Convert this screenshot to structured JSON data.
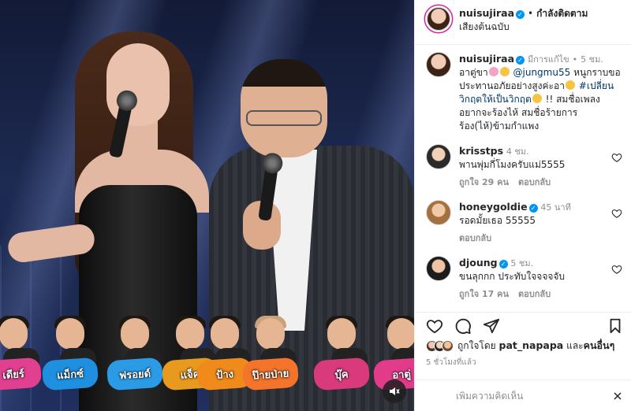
{
  "header": {
    "username": "nuisujiraa",
    "follow_state": "กำลังติดตาม",
    "audio": "เสียงต้นฉบับ",
    "more_label": "..."
  },
  "caption": {
    "username": "nuisujiraa",
    "edited": "มีการแก้ไข",
    "time": "5 ชม.",
    "text_prefix": "อาตู่ขา",
    "mention": "@jungmu55",
    "text_mid": "หนูกราบขอประทานอภัยอย่างสูงค่ะอา",
    "hashtag": "#เปลี่ยนวิกฤตให้เป็นวิกฤต",
    "text_suffix": "!! สมชื่อเพลง อยากจะร้องไห้ สมชื่อร้ายการ ร้อง(ไห้)ข้ามกำแพง"
  },
  "comments": [
    {
      "username": "krisstps",
      "verified": false,
      "time": "4 ชม.",
      "text": "พานพุ่มกี่โมงครับแม่5555",
      "likes": "ถูกใจ 29 คน",
      "reply": "ตอบกลับ"
    },
    {
      "username": "honeygoldie",
      "verified": true,
      "time": "45 นาที",
      "text": "รอดมั้ยเธอ 55555",
      "likes": "",
      "reply": "ตอบกลับ"
    },
    {
      "username": "djoung",
      "verified": true,
      "time": "5 ชม.",
      "text": "ขนลุกกก ประทับใจจจจจับ",
      "likes": "ถูกใจ 17 คน",
      "reply": "ตอบกลับ"
    }
  ],
  "likes": {
    "prefix": "ถูกใจโดย",
    "user": "pat_napapa",
    "and_word": "และ",
    "others": "คนอื่นๆ"
  },
  "posted": "5 ชั่วโมงที่แล้ว",
  "composer": {
    "placeholder": "เพิ่มความคิดเห็น"
  },
  "cast": [
    "เดียร์",
    "แม็กซ์",
    "ฟรอยด์",
    "แจ็ค",
    "ป้าง",
    "ป๊ายป่าย",
    "บุ๊ค",
    "อาตู่"
  ],
  "colors": {
    "accent": "#0095f6",
    "muted": "#8e8e8e",
    "link": "#00376b"
  }
}
